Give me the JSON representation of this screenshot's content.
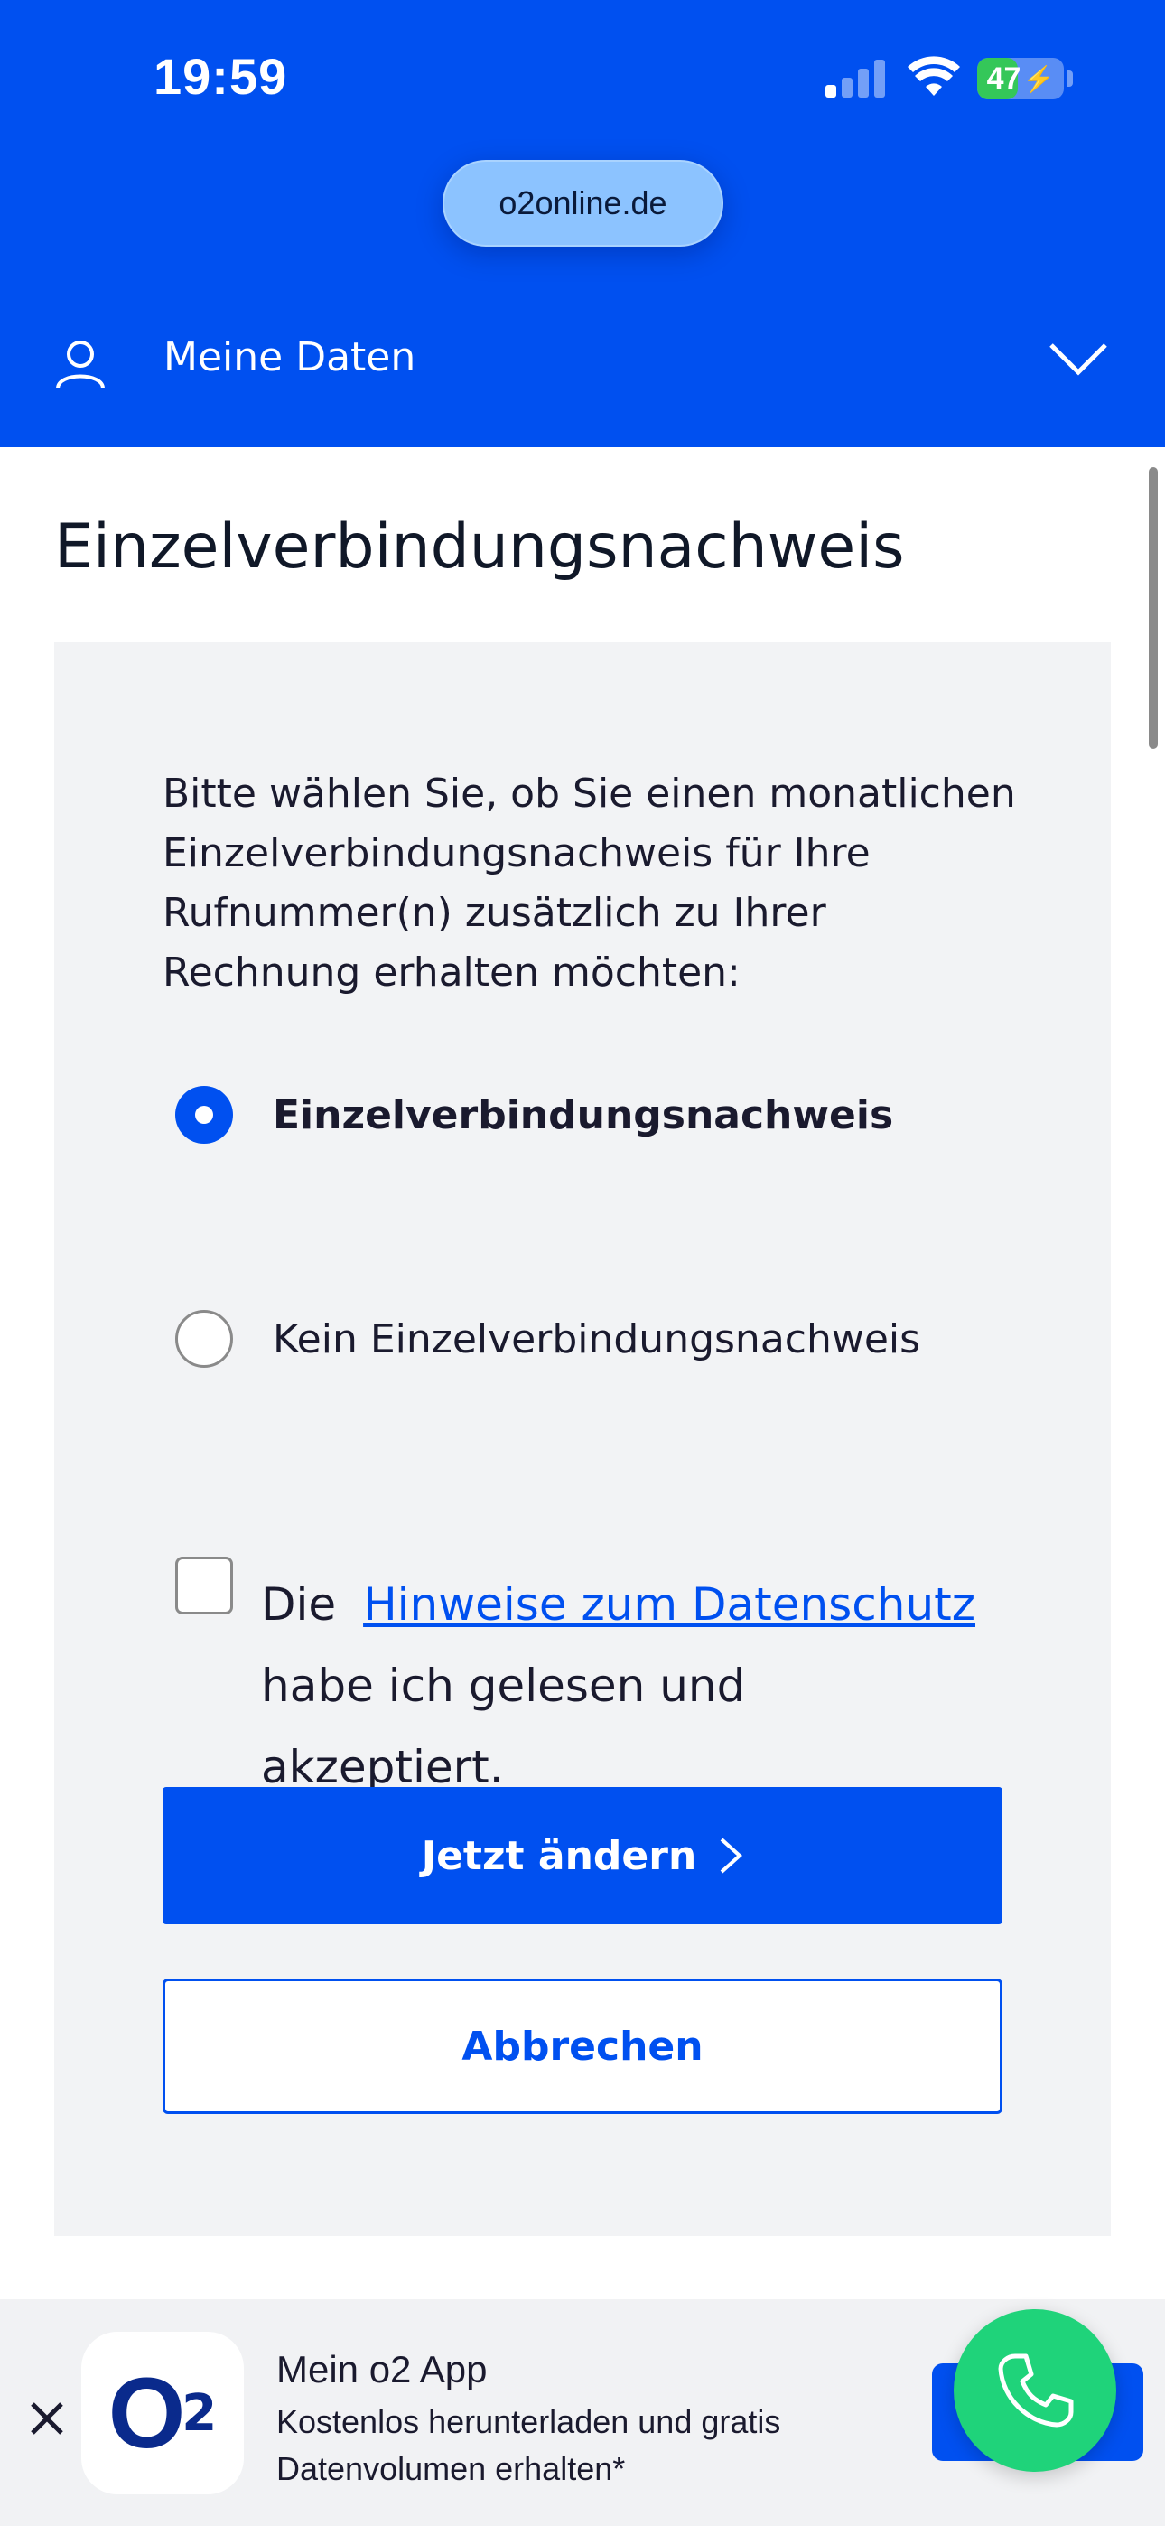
{
  "status_bar": {
    "time": "19:59",
    "battery_percent": "47",
    "battery_level": 0.47
  },
  "browser": {
    "url": "o2online.de"
  },
  "nav": {
    "title": "Meine Daten",
    "icons": [
      "user-icon",
      "chevron-down-icon"
    ]
  },
  "page": {
    "title": "Einzelverbindungsnachweis"
  },
  "form": {
    "intro": "Bitte wählen Sie, ob Sie einen monatlichen Einzelverbindungsnachweis für Ihre Rufnummer(n) zusätzlich zu Ihrer Rechnung erhalten möchten:",
    "options": [
      {
        "label": "Einzelverbindungsnachweis",
        "selected": true
      },
      {
        "label": "Kein Einzelverbindungsnachweis",
        "selected": false
      }
    ],
    "privacy": {
      "prefix": "Die",
      "link": "Hinweise zum Datenschutz",
      "suffix": "habe ich gelesen und akzeptiert.",
      "checked": false
    },
    "submit_label": "Jetzt ändern",
    "cancel_label": "Abbrechen"
  },
  "banner": {
    "app_name": "Mein o2 App",
    "description": "Kostenlos herunterladen und gratis Datenvolumen erhalten*",
    "logo_letter": "O",
    "logo_sub": "2"
  },
  "colors": {
    "brand_blue": "#0050f0",
    "call_green": "#1fd37a",
    "card_bg": "#f2f3f5"
  }
}
